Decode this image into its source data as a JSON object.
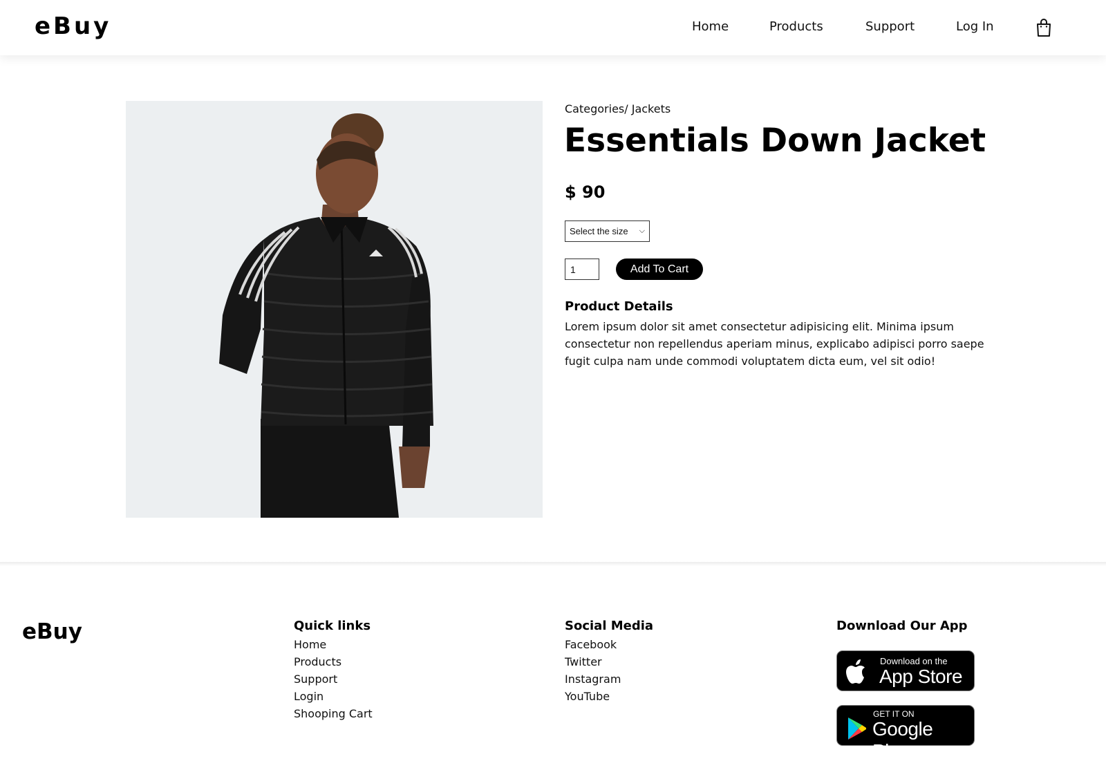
{
  "header": {
    "logo": "eBuy",
    "nav": [
      "Home",
      "Products",
      "Support",
      "Log In"
    ],
    "cart_icon": "shopping-bag-icon"
  },
  "product": {
    "breadcrumb": "Categories/ Jackets",
    "title": "Essentials Down Jacket",
    "price": "$ 90",
    "size_select": "Select the size",
    "quantity": "1",
    "add_to_cart": "Add To Cart",
    "details_heading": "Product Details",
    "details_text": "Lorem ipsum dolor sit amet consectetur adipisicing elit. Minima ipsum consectetur non repellendus aperiam minus, explicabo adipisci porro saepe fugit culpa nam unde commodi voluptatem dicta eum, vel sit odio!"
  },
  "footer": {
    "logo": "eBuy",
    "quick_links": {
      "heading": "Quick links",
      "items": [
        "Home",
        "Products",
        "Support",
        "Login",
        "Shooping Cart"
      ]
    },
    "social_media": {
      "heading": "Social Media",
      "items": [
        "Facebook",
        "Twitter",
        "Instagram",
        "YouTube"
      ]
    },
    "app": {
      "heading": "Download Our App",
      "appstore_small": "Download on the",
      "appstore_big": "App Store",
      "googleplay_small": "GET IT ON",
      "googleplay_big": "Google Play"
    }
  },
  "colors": {
    "image_background": "#eceff1",
    "button": "#000000",
    "text": "#111111"
  }
}
